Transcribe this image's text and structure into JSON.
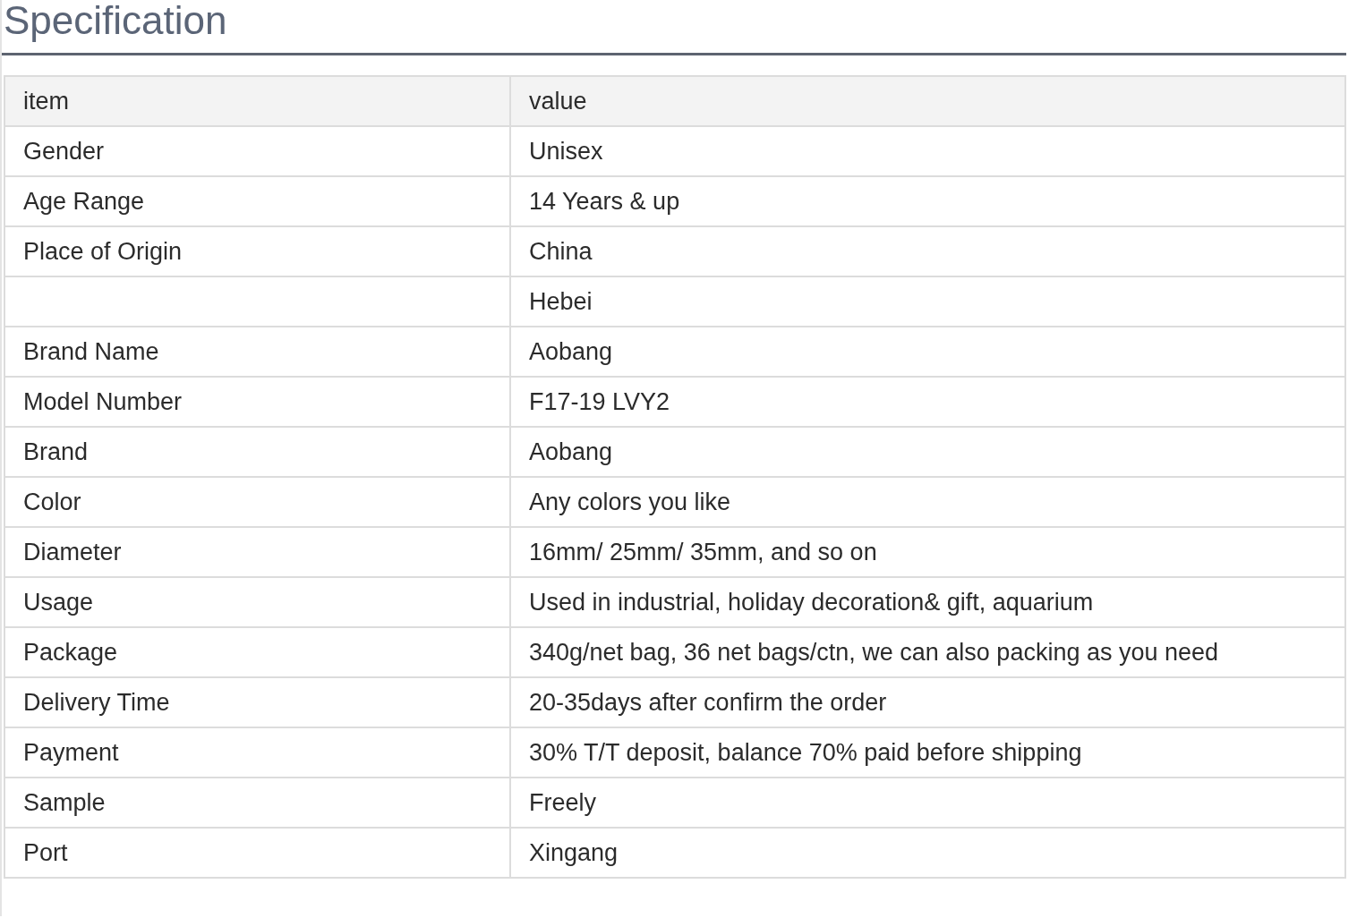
{
  "title": "Specification",
  "table": {
    "columns": [
      "item",
      "value"
    ],
    "rows": [
      {
        "item": "Gender",
        "value": "Unisex"
      },
      {
        "item": "Age Range",
        "value": "14 Years & up"
      },
      {
        "item": "Place of Origin",
        "value": "China"
      },
      {
        "item": "",
        "value": "Hebei"
      },
      {
        "item": "Brand Name",
        "value": "Aobang"
      },
      {
        "item": "Model Number",
        "value": "F17-19 LVY2"
      },
      {
        "item": "Brand",
        "value": "Aobang"
      },
      {
        "item": "Color",
        "value": "Any colors you like"
      },
      {
        "item": "Diameter",
        "value": "16mm/ 25mm/ 35mm, and so on"
      },
      {
        "item": "Usage",
        "value": "Used in industrial, holiday decoration& gift, aquarium"
      },
      {
        "item": "Package",
        "value": "340g/net bag, 36 net bags/ctn, we can also packing as you need"
      },
      {
        "item": "Delivery Time",
        "value": "20-35days after confirm the order"
      },
      {
        "item": "Payment",
        "value": "30% T/T deposit, balance 70% paid before shipping"
      },
      {
        "item": "Sample",
        "value": "Freely"
      },
      {
        "item": "Port",
        "value": "Xingang"
      }
    ]
  }
}
